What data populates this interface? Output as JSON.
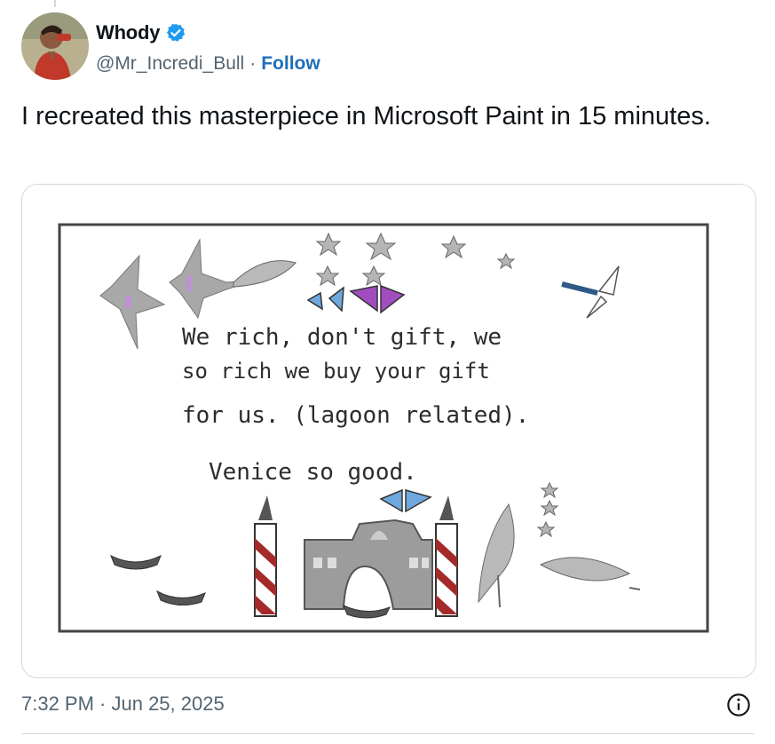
{
  "author": {
    "display_name": "Whody",
    "handle": "@Mr_Incredi_Bull",
    "separator": "·",
    "follow_label": "Follow",
    "verified": true
  },
  "tweet": {
    "text": "I recreated this masterpiece in Microsoft Paint in 15 minutes."
  },
  "media": {
    "drawing_lines": [
      "We rich, don't gift, we",
      "so rich we buy your gift",
      "for us. (lagoon related).",
      "Venice so good."
    ]
  },
  "footer": {
    "timestamp": "7:32 PM · Jun 25, 2025"
  },
  "colors": {
    "accent": "#1d9bf0",
    "follow": "#1d6fb8",
    "muted": "#536471",
    "border": "#cfd9de"
  },
  "icons": [
    "verified-badge-icon",
    "info-icon"
  ]
}
